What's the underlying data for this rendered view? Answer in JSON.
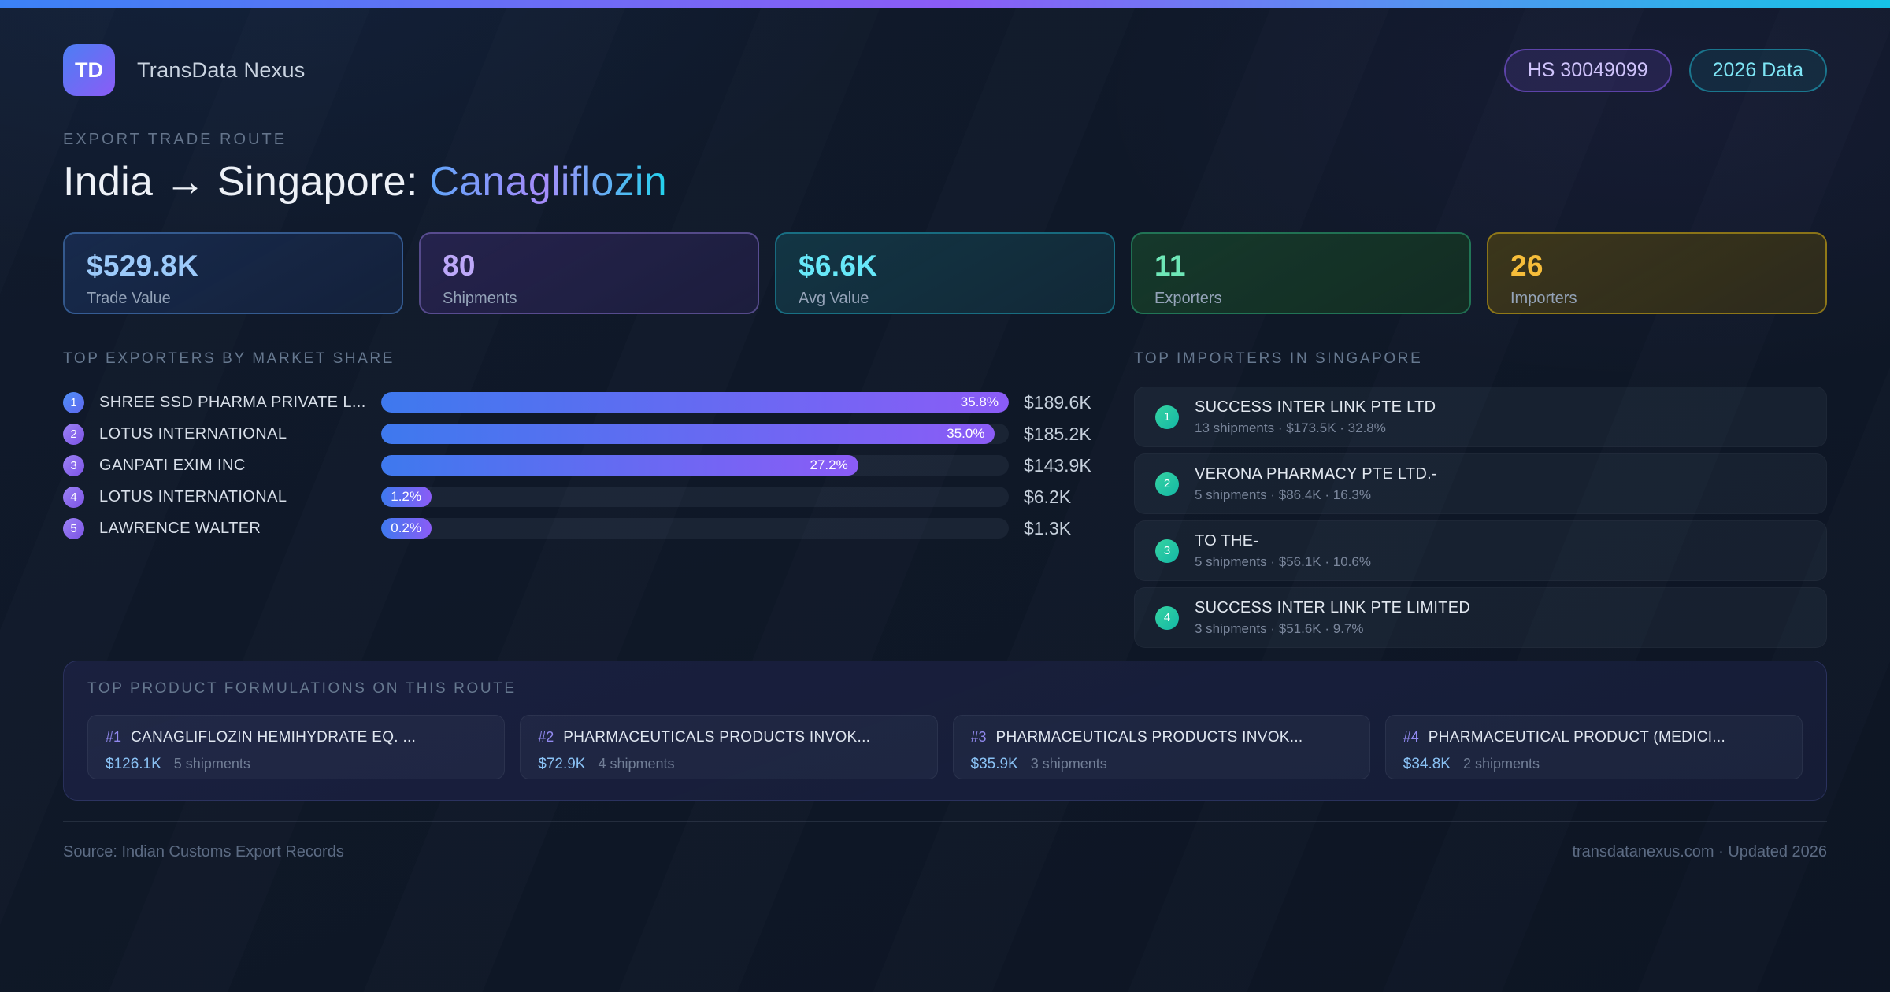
{
  "colors": {
    "accent_blue": "#3b82f6",
    "accent_purple": "#8b5cf6",
    "accent_cyan": "#22d3ee",
    "accent_green": "#34d399",
    "accent_amber": "#fbbf24",
    "bar_gradient_start": "#3e79ee",
    "bar_gradient_end": "#8b5cf6",
    "importer_badge": "#14b8a6",
    "background": "#0f1828"
  },
  "header": {
    "logo_text": "TD",
    "app_name": "TransData Nexus",
    "hs_badge": "HS 30049099",
    "year_badge": "2026 Data"
  },
  "hero": {
    "eyebrow": "EXPORT TRADE ROUTE",
    "route": "India → Singapore:",
    "product": "Canagliflozin"
  },
  "stats": {
    "cards": [
      {
        "value": "$529.8K",
        "label": "Trade Value",
        "theme": "blue"
      },
      {
        "value": "80",
        "label": "Shipments",
        "theme": "purple"
      },
      {
        "value": "$6.6K",
        "label": "Avg Value",
        "theme": "cyan"
      },
      {
        "value": "11",
        "label": "Exporters",
        "theme": "green"
      },
      {
        "value": "26",
        "label": "Importers",
        "theme": "amber"
      }
    ]
  },
  "exporters": {
    "heading": "TOP EXPORTERS BY MARKET SHARE",
    "max_pct": 35.8,
    "rows": [
      {
        "rank": "1",
        "name": "SHREE SSD PHARMA PRIVATE L...",
        "pct": "35.8%",
        "pct_value": 35.8,
        "value": "$189.6K",
        "accent": "blue"
      },
      {
        "rank": "2",
        "name": "LOTUS INTERNATIONAL",
        "pct": "35.0%",
        "pct_value": 35.0,
        "value": "$185.2K",
        "accent": "purple"
      },
      {
        "rank": "3",
        "name": "GANPATI EXIM INC",
        "pct": "27.2%",
        "pct_value": 27.2,
        "value": "$143.9K",
        "accent": "purple"
      },
      {
        "rank": "4",
        "name": "LOTUS INTERNATIONAL",
        "pct": "1.2%",
        "pct_value": 1.2,
        "value": "$6.2K",
        "accent": "purple"
      },
      {
        "rank": "5",
        "name": "LAWRENCE WALTER",
        "pct": "0.2%",
        "pct_value": 0.2,
        "value": "$1.3K",
        "accent": "purple"
      }
    ]
  },
  "importers": {
    "heading": "TOP IMPORTERS IN SINGAPORE",
    "rows": [
      {
        "rank": "1",
        "name": "SUCCESS INTER LINK PTE LTD",
        "meta": "13 shipments · $173.5K · 32.8%"
      },
      {
        "rank": "2",
        "name": "VERONA PHARMACY PTE LTD.-",
        "meta": "5 shipments · $86.4K · 16.3%"
      },
      {
        "rank": "3",
        "name": "TO THE-",
        "meta": "5 shipments · $56.1K · 10.6%"
      },
      {
        "rank": "4",
        "name": "SUCCESS INTER LINK PTE LIMITED",
        "meta": "3 shipments · $51.6K · 9.7%"
      }
    ]
  },
  "formulations": {
    "heading": "TOP PRODUCT FORMULATIONS ON THIS ROUTE",
    "cards": [
      {
        "num": "#1",
        "name": "CANAGLIFLOZIN HEMIHYDRATE EQ. ...",
        "value": "$126.1K",
        "shipments": "5 shipments"
      },
      {
        "num": "#2",
        "name": "PHARMACEUTICALS PRODUCTS INVOK...",
        "value": "$72.9K",
        "shipments": "4 shipments"
      },
      {
        "num": "#3",
        "name": "PHARMACEUTICALS PRODUCTS INVOK...",
        "value": "$35.9K",
        "shipments": "3 shipments"
      },
      {
        "num": "#4",
        "name": "PHARMACEUTICAL PRODUCT (MEDICI...",
        "value": "$34.8K",
        "shipments": "2 shipments"
      }
    ]
  },
  "footer": {
    "source": "Source: Indian Customs Export Records",
    "site": "transdatanexus.com · Updated 2026"
  }
}
